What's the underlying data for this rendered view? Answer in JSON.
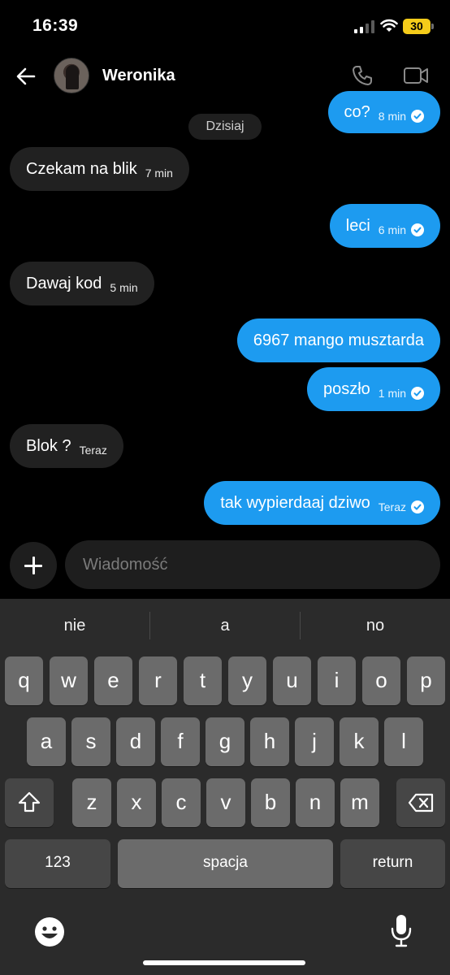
{
  "status": {
    "time": "16:39",
    "battery": "30"
  },
  "chat": {
    "contact_name": "Weronika",
    "date_label": "Dzisiaj",
    "messages": [
      {
        "direction": "out",
        "text": "co?",
        "time": "8 min",
        "read": true
      },
      {
        "direction": "in",
        "text": "Czekam na blik",
        "time": "7 min"
      },
      {
        "direction": "out",
        "text": "leci",
        "time": "6 min",
        "read": true
      },
      {
        "direction": "in",
        "text": "Dawaj kod",
        "time": "5 min"
      },
      {
        "direction": "out",
        "text": "6967 mango musztarda",
        "time": "",
        "read": false
      },
      {
        "direction": "out",
        "text": "poszło",
        "time": "1 min",
        "read": true
      },
      {
        "direction": "in",
        "text": "Blok ?",
        "time": "Teraz"
      },
      {
        "direction": "out",
        "text": "tak wypierdaaj dziwo",
        "time": "Teraz",
        "read": true
      }
    ]
  },
  "composer": {
    "placeholder": "Wiadomość"
  },
  "keyboard": {
    "suggestions": [
      "nie",
      "a",
      "no"
    ],
    "row1": [
      "q",
      "w",
      "e",
      "r",
      "t",
      "y",
      "u",
      "i",
      "o",
      "p"
    ],
    "row2": [
      "a",
      "s",
      "d",
      "f",
      "g",
      "h",
      "j",
      "k",
      "l"
    ],
    "row3": [
      "z",
      "x",
      "c",
      "v",
      "b",
      "n",
      "m"
    ],
    "numbers_key": "123",
    "space_key": "spacja",
    "return_key": "return"
  },
  "colors": {
    "outgoing": "#1d9bf0",
    "incoming": "#212121",
    "battery": "#f5cc1a"
  },
  "icons": [
    "back-arrow-icon",
    "phone-icon",
    "video-camera-icon",
    "checkmark-icon",
    "plus-icon",
    "shift-icon",
    "backspace-icon",
    "emoji-icon",
    "microphone-icon",
    "wifi-icon",
    "signal-icon",
    "battery-icon"
  ]
}
